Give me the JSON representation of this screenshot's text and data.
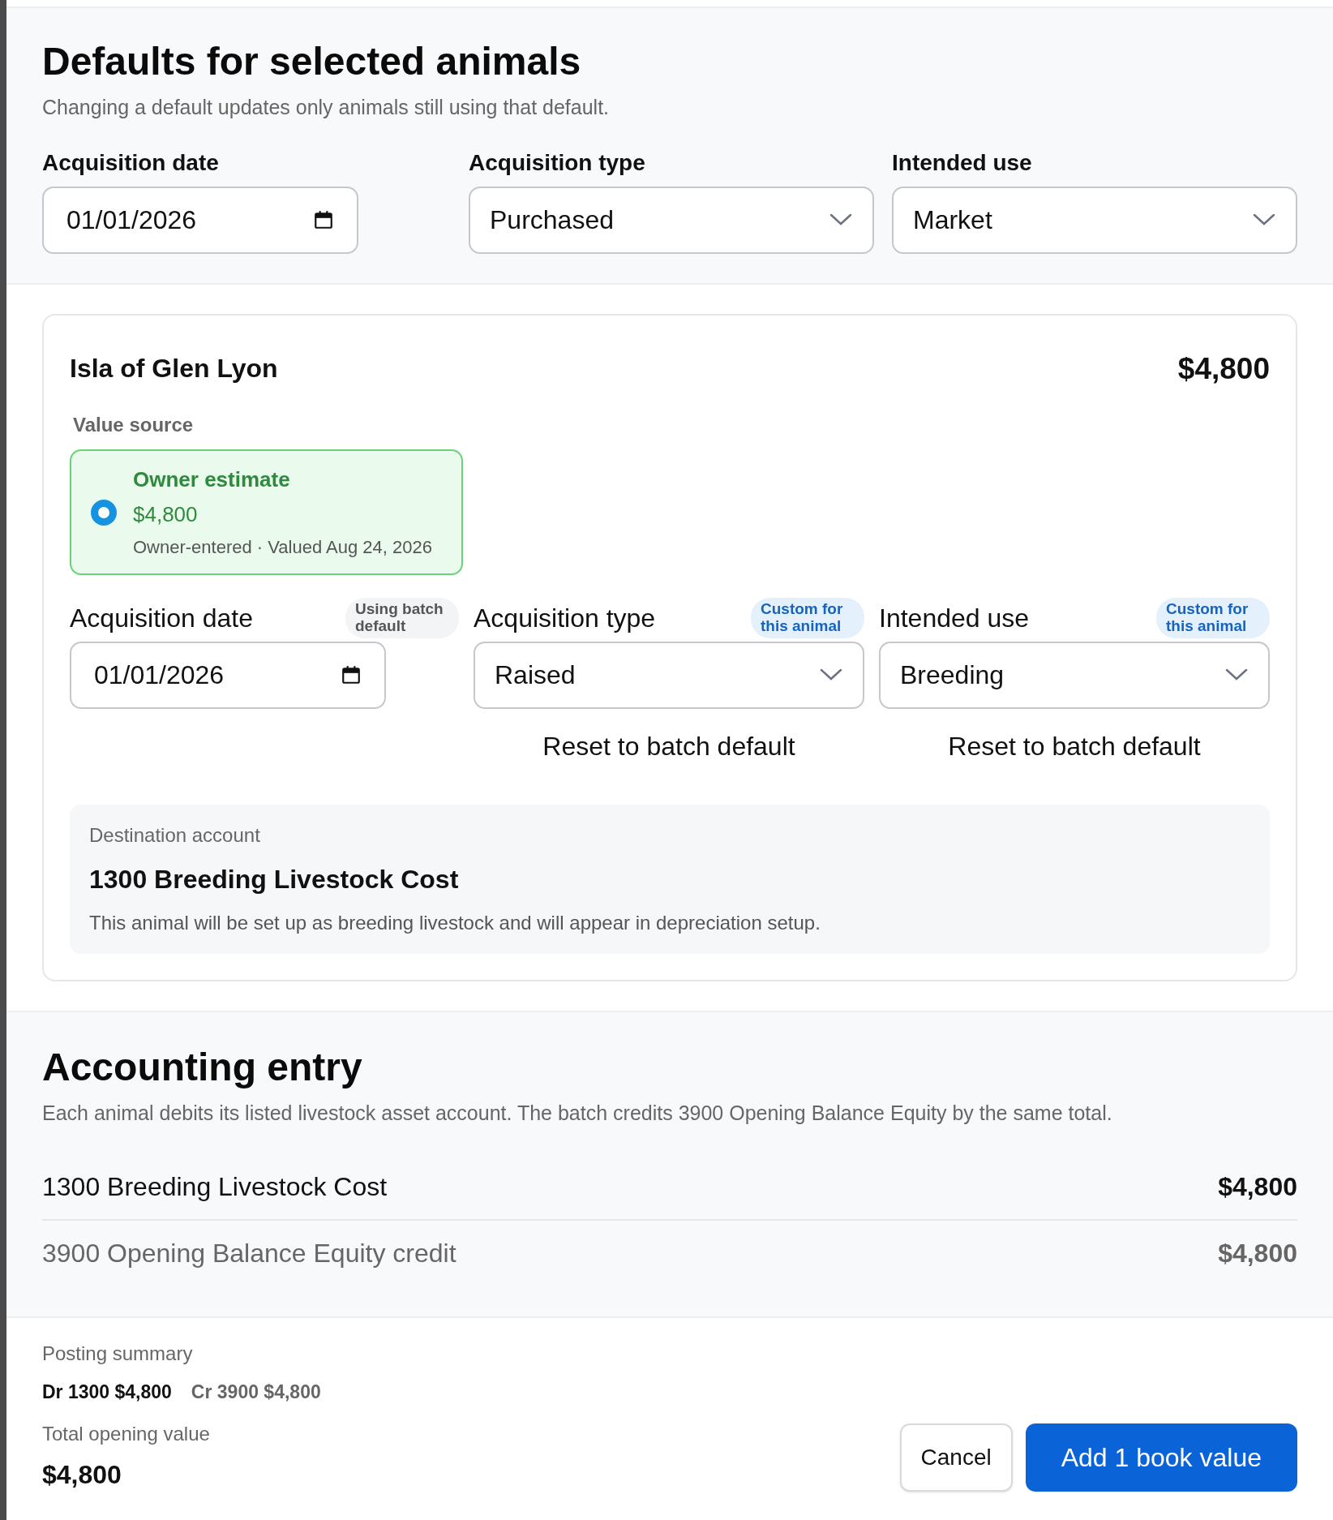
{
  "defaults": {
    "title": "Defaults for selected animals",
    "subtitle": "Changing a default updates only animals still using that default.",
    "fields": [
      {
        "kind": "date",
        "label": "Acquisition date",
        "value": "01/01/2026"
      },
      {
        "kind": "select",
        "label": "Acquisition type",
        "value": "Purchased"
      },
      {
        "kind": "select",
        "label": "Intended use",
        "value": "Market"
      }
    ]
  },
  "animal": {
    "name": "Isla of Glen Lyon",
    "value": "$4,800",
    "value_source": {
      "label": "Value source",
      "options": [
        {
          "title": "Owner estimate",
          "amount": "$4,800",
          "meta": "Owner-entered · Valued Aug 24, 2026",
          "selected": true
        }
      ]
    },
    "fields": [
      {
        "kind": "date",
        "label": "Acquisition date",
        "badge": {
          "text": "Using batch default",
          "kind": "batch"
        },
        "value": "01/01/2026"
      },
      {
        "kind": "select",
        "label": "Acquisition type",
        "badge": {
          "text": "Custom for this animal",
          "kind": "custom"
        },
        "value": "Raised",
        "reset": "Reset to batch default"
      },
      {
        "kind": "select",
        "label": "Intended use",
        "badge": {
          "text": "Custom for this animal",
          "kind": "custom"
        },
        "value": "Breeding",
        "reset": "Reset to batch default"
      }
    ],
    "destination": {
      "label": "Destination account",
      "account": "1300 Breeding Livestock Cost",
      "note": "This animal will be set up as breeding livestock and will appear in depreciation setup."
    }
  },
  "accounting": {
    "title": "Accounting entry",
    "description": "Each animal debits its listed livestock asset account. The batch credits 3900 Opening Balance Equity by the same total.",
    "lines": [
      {
        "kind": "debit",
        "account": "1300 Breeding Livestock Cost",
        "amount": "$4,800"
      },
      {
        "kind": "credit",
        "account": "3900 Opening Balance Equity credit",
        "amount": "$4,800"
      }
    ]
  },
  "footer": {
    "posting_label": "Posting summary",
    "posting": [
      {
        "kind": "debit",
        "text": "Dr 1300 $4,800"
      },
      {
        "kind": "credit",
        "text": "Cr 3900 $4,800"
      }
    ],
    "total_label": "Total opening value",
    "total": "$4,800",
    "buttons": [
      {
        "kind": "secondary",
        "label": "Cancel"
      },
      {
        "kind": "primary",
        "label": "Add 1 book value"
      }
    ]
  }
}
